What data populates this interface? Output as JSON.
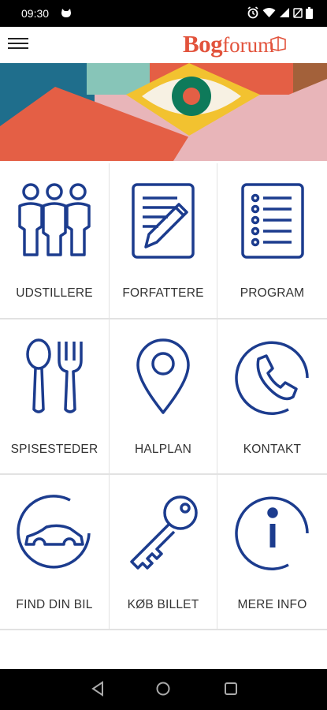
{
  "status_bar": {
    "time": "09:30",
    "icons": [
      "cat-icon",
      "alarm-icon",
      "wifi-icon",
      "signal-icon",
      "battery-saver-icon",
      "battery-icon"
    ]
  },
  "app_bar": {
    "logo_bold": "Bog",
    "logo_light": "forum",
    "menu_icon": "hamburger-menu-icon"
  },
  "banner": {
    "icon": "eye-icon",
    "colors": [
      "#1f6e8c",
      "#87c5b8",
      "#e45f45",
      "#f2c230",
      "#e8b5b9",
      "#a3613a"
    ]
  },
  "tiles": [
    {
      "label": "UDSTILLERE",
      "icon": "people-icon"
    },
    {
      "label": "FORFATTERE",
      "icon": "document-pencil-icon"
    },
    {
      "label": "PROGRAM",
      "icon": "list-icon"
    },
    {
      "label": "SPISESTEDER",
      "icon": "spoon-fork-icon"
    },
    {
      "label": "HALPLAN",
      "icon": "map-pin-icon"
    },
    {
      "label": "KONTAKT",
      "icon": "phone-icon"
    },
    {
      "label": "FIND DIN BIL",
      "icon": "car-icon"
    },
    {
      "label": "KØB BILLET",
      "icon": "key-icon"
    },
    {
      "label": "MERE INFO",
      "icon": "info-icon"
    }
  ],
  "nav_bar": {
    "buttons": [
      "back-icon",
      "home-icon",
      "recents-icon"
    ]
  },
  "colors": {
    "icon_blue": "#1c3c8e",
    "accent": "#e2533c"
  }
}
